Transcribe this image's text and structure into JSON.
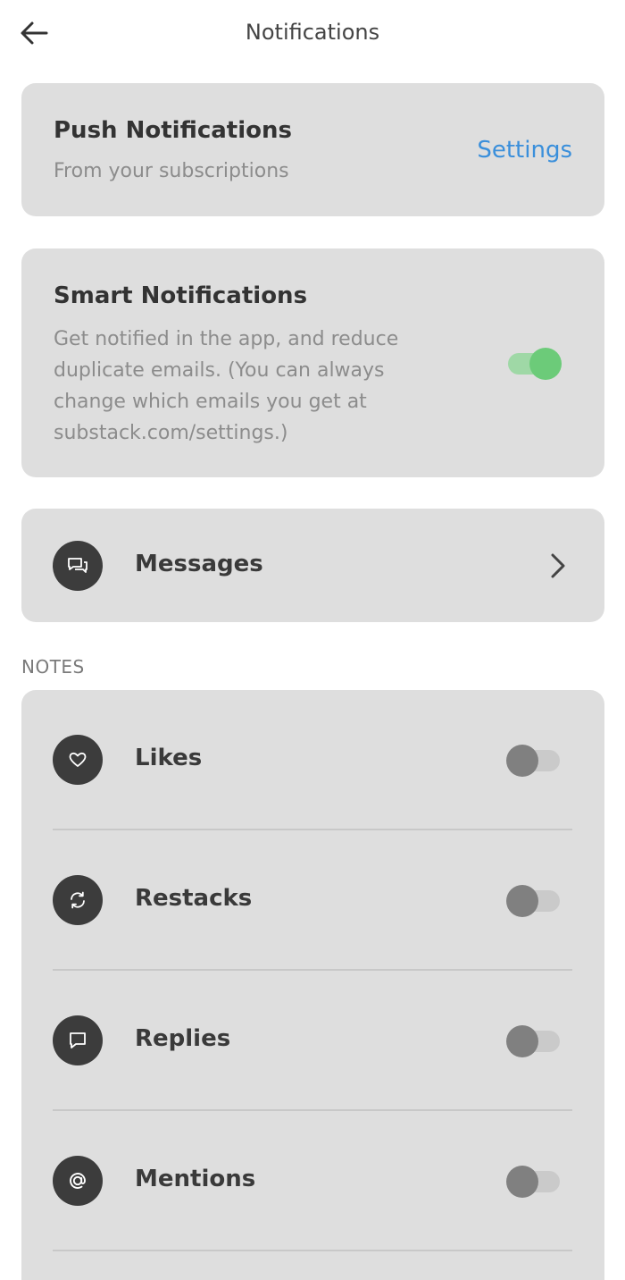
{
  "header": {
    "title": "Notifications"
  },
  "push": {
    "title": "Push Notifications",
    "subtitle": "From your subscriptions",
    "settings_label": "Settings"
  },
  "smart": {
    "title": "Smart Notifications",
    "description": "Get notified in the app, and reduce duplicate emails. (You can always change which emails you get at substack.com/settings.)",
    "enabled": true
  },
  "messages": {
    "label": "Messages"
  },
  "notes": {
    "section_label": "NOTES",
    "items": [
      {
        "label": "Likes",
        "icon": "heart-icon",
        "enabled": false
      },
      {
        "label": "Restacks",
        "icon": "restack-icon",
        "enabled": false
      },
      {
        "label": "Replies",
        "icon": "reply-bubble-icon",
        "enabled": false
      },
      {
        "label": "Mentions",
        "icon": "at-sign-icon",
        "enabled": false
      }
    ]
  },
  "colors": {
    "card_bg": "#dedede",
    "accent_link": "#3a8fdb",
    "toggle_on": "#6ccb79",
    "toggle_off": "#808080",
    "icon_bg": "#3c3c3c"
  }
}
